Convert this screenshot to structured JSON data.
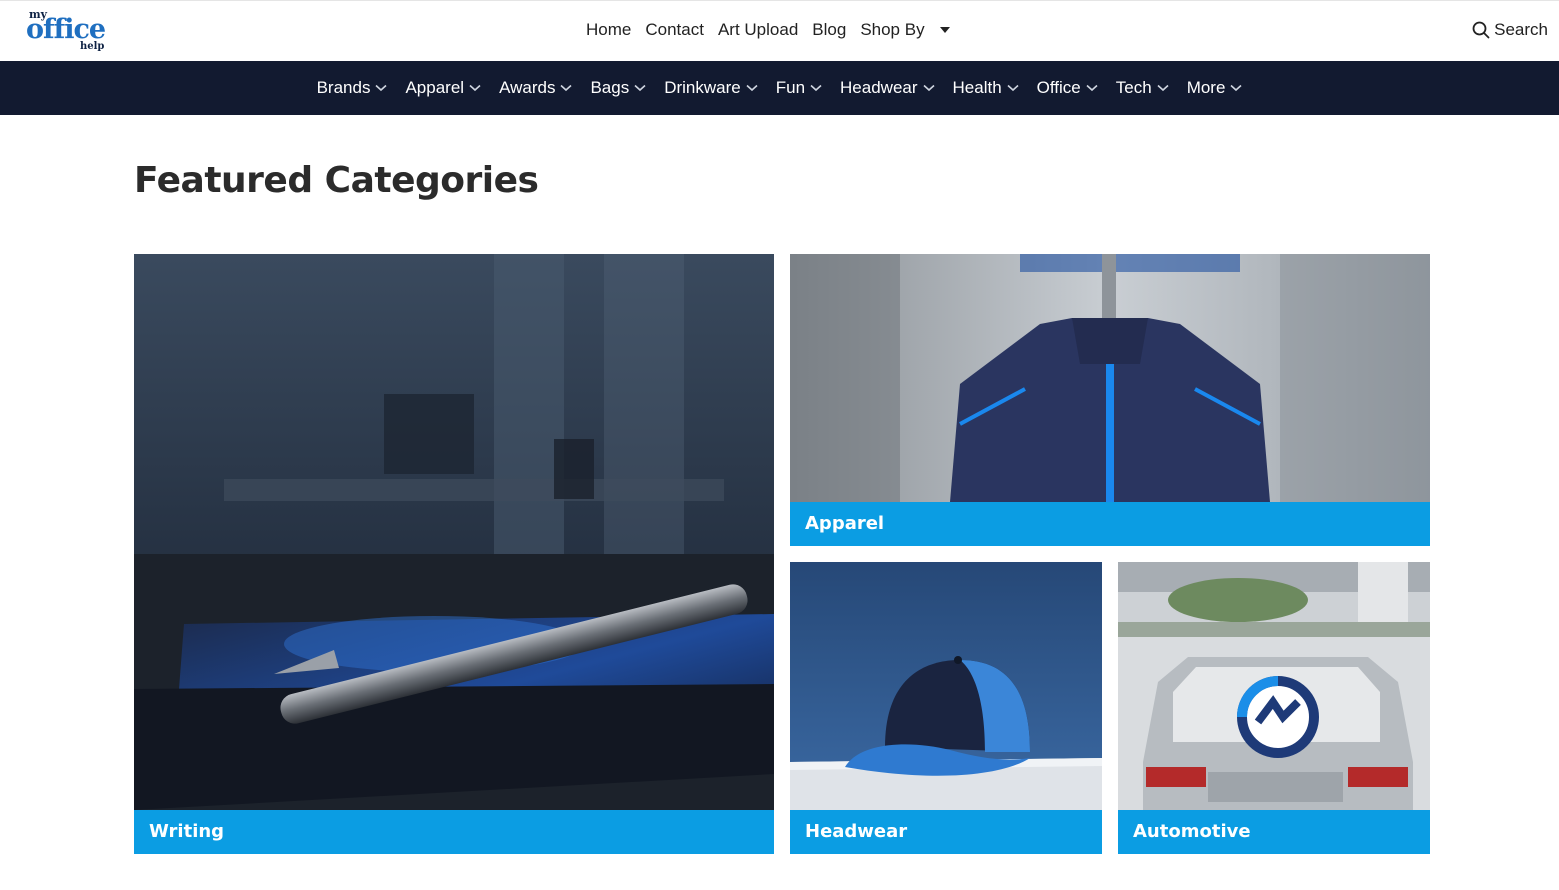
{
  "brand": {
    "logo_top": "my",
    "logo_main": "office",
    "logo_sub": "help"
  },
  "top_nav": {
    "items": [
      "Home",
      "Contact",
      "Art Upload",
      "Blog",
      "Shop By"
    ],
    "search_label": "Search"
  },
  "category_nav": {
    "items": [
      "Brands",
      "Apparel",
      "Awards",
      "Bags",
      "Drinkware",
      "Fun",
      "Headwear",
      "Health",
      "Office",
      "Tech",
      "More"
    ]
  },
  "featured": {
    "title": "Featured Categories",
    "tiles": [
      {
        "label": "Writing"
      },
      {
        "label": "Apparel"
      },
      {
        "label": "Headwear"
      },
      {
        "label": "Automotive"
      }
    ]
  },
  "colors": {
    "nav_bg": "#121a30",
    "tile_label_bg": "#0b9de3",
    "logo_blue": "#1f6fc0"
  }
}
